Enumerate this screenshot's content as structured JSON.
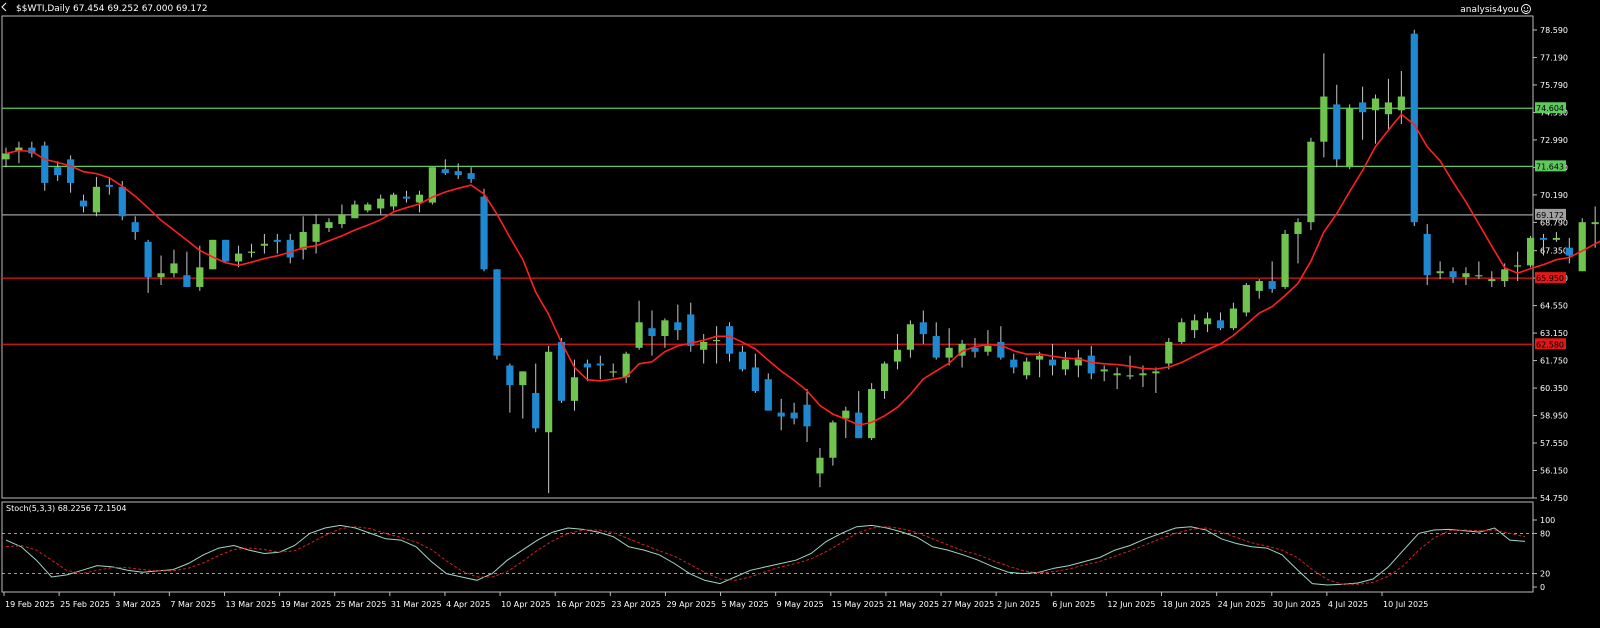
{
  "header": {
    "symbol_info": "$$WTI,Daily  67.454 69.252 67.000 69.172",
    "watermark": "analysis4you"
  },
  "chart_data": [
    {
      "type": "candlestick",
      "symbol": "$$WTI",
      "timeframe": "Daily",
      "ohlc_last": {
        "open": 67.454,
        "high": 69.252,
        "low": 67.0,
        "close": 69.172
      },
      "ylim": [
        54.75,
        79.2
      ],
      "y_ticks": [
        "78.590",
        "77.190",
        "75.790",
        "74.390",
        "72.990",
        "71.590",
        "70.190",
        "68.790",
        "67.350",
        "65.950",
        "64.550",
        "63.150",
        "61.750",
        "60.350",
        "58.950",
        "57.550",
        "56.150",
        "54.750"
      ],
      "x_tick_labels": [
        "19 Feb 2025",
        "25 Feb 2025",
        "3 Mar 2025",
        "7 Mar 2025",
        "13 Mar 2025",
        "19 Mar 2025",
        "25 Mar 2025",
        "31 Mar 2025",
        "4 Apr 2025",
        "10 Apr 2025",
        "16 Apr 2025",
        "23 Apr 2025",
        "29 Apr 2025",
        "5 May 2025",
        "9 May 2025",
        "15 May 2025",
        "21 May 2025",
        "27 May 2025",
        "2 Jun 2025",
        "6 Jun 2025",
        "12 Jun 2025",
        "18 Jun 2025",
        "24 Jun 2025",
        "30 Jun 2025",
        "4 Jul 2025",
        "10 Jul 2025"
      ],
      "candles": [
        {
          "o": 72.0,
          "h": 72.6,
          "l": 71.6,
          "c": 72.3
        },
        {
          "o": 72.4,
          "h": 72.9,
          "l": 71.8,
          "c": 72.6
        },
        {
          "o": 72.6,
          "h": 72.9,
          "l": 72.1,
          "c": 72.3
        },
        {
          "o": 72.7,
          "h": 72.9,
          "l": 70.4,
          "c": 70.8
        },
        {
          "o": 71.6,
          "h": 71.9,
          "l": 70.9,
          "c": 71.2
        },
        {
          "o": 72.0,
          "h": 72.2,
          "l": 70.3,
          "c": 70.8
        },
        {
          "o": 69.9,
          "h": 70.2,
          "l": 69.3,
          "c": 69.6
        },
        {
          "o": 69.3,
          "h": 71.1,
          "l": 69.1,
          "c": 70.6
        },
        {
          "o": 70.7,
          "h": 71.1,
          "l": 70.2,
          "c": 70.6
        },
        {
          "o": 70.6,
          "h": 70.9,
          "l": 68.9,
          "c": 69.1
        },
        {
          "o": 68.8,
          "h": 69.1,
          "l": 67.9,
          "c": 68.3
        },
        {
          "o": 67.8,
          "h": 67.9,
          "l": 65.2,
          "c": 66.0
        },
        {
          "o": 66.0,
          "h": 67.1,
          "l": 65.6,
          "c": 66.2
        },
        {
          "o": 66.2,
          "h": 67.4,
          "l": 66.0,
          "c": 66.7
        },
        {
          "o": 66.1,
          "h": 67.3,
          "l": 65.5,
          "c": 65.5
        },
        {
          "o": 65.5,
          "h": 67.6,
          "l": 65.3,
          "c": 66.5
        },
        {
          "o": 66.4,
          "h": 67.9,
          "l": 66.4,
          "c": 67.9
        },
        {
          "o": 67.9,
          "h": 67.9,
          "l": 66.7,
          "c": 66.8
        },
        {
          "o": 66.8,
          "h": 67.6,
          "l": 66.5,
          "c": 67.2
        },
        {
          "o": 67.3,
          "h": 67.7,
          "l": 67.0,
          "c": 67.3
        },
        {
          "o": 67.6,
          "h": 68.2,
          "l": 67.2,
          "c": 67.7
        },
        {
          "o": 67.9,
          "h": 68.2,
          "l": 67.2,
          "c": 67.8
        },
        {
          "o": 67.9,
          "h": 68.2,
          "l": 66.7,
          "c": 67.0
        },
        {
          "o": 67.4,
          "h": 69.1,
          "l": 66.9,
          "c": 68.3
        },
        {
          "o": 67.8,
          "h": 69.2,
          "l": 67.2,
          "c": 68.7
        },
        {
          "o": 68.5,
          "h": 69.0,
          "l": 68.3,
          "c": 68.8
        },
        {
          "o": 68.7,
          "h": 69.7,
          "l": 68.5,
          "c": 69.2
        },
        {
          "o": 69.0,
          "h": 69.9,
          "l": 69.0,
          "c": 69.7
        },
        {
          "o": 69.4,
          "h": 69.8,
          "l": 69.3,
          "c": 69.7
        },
        {
          "o": 69.5,
          "h": 70.2,
          "l": 69.2,
          "c": 70.0
        },
        {
          "o": 69.6,
          "h": 70.3,
          "l": 69.4,
          "c": 70.2
        },
        {
          "o": 70.1,
          "h": 70.4,
          "l": 69.8,
          "c": 70.0
        },
        {
          "o": 69.8,
          "h": 70.4,
          "l": 69.3,
          "c": 70.2
        },
        {
          "o": 69.8,
          "h": 71.6,
          "l": 69.7,
          "c": 71.6
        },
        {
          "o": 71.5,
          "h": 72.0,
          "l": 71.2,
          "c": 71.3
        },
        {
          "o": 71.4,
          "h": 71.8,
          "l": 71.0,
          "c": 71.2
        },
        {
          "o": 71.3,
          "h": 71.6,
          "l": 70.8,
          "c": 71.0
        },
        {
          "o": 70.1,
          "h": 70.5,
          "l": 66.3,
          "c": 66.4
        },
        {
          "o": 66.4,
          "h": 66.4,
          "l": 61.8,
          "c": 62.0
        },
        {
          "o": 61.5,
          "h": 61.6,
          "l": 59.1,
          "c": 60.5
        },
        {
          "o": 60.5,
          "h": 61.2,
          "l": 58.8,
          "c": 61.2
        },
        {
          "o": 60.1,
          "h": 61.6,
          "l": 58.1,
          "c": 58.3
        },
        {
          "o": 58.1,
          "h": 62.5,
          "l": 55.0,
          "c": 62.2
        },
        {
          "o": 62.7,
          "h": 62.9,
          "l": 59.6,
          "c": 59.7
        },
        {
          "o": 59.7,
          "h": 61.8,
          "l": 59.2,
          "c": 60.9
        },
        {
          "o": 61.6,
          "h": 61.8,
          "l": 60.7,
          "c": 61.4
        },
        {
          "o": 61.6,
          "h": 62.0,
          "l": 60.8,
          "c": 61.5
        },
        {
          "o": 61.2,
          "h": 61.6,
          "l": 60.9,
          "c": 61.2
        },
        {
          "o": 60.9,
          "h": 62.2,
          "l": 60.6,
          "c": 62.1
        },
        {
          "o": 62.4,
          "h": 64.8,
          "l": 62.3,
          "c": 63.7
        },
        {
          "o": 63.4,
          "h": 64.3,
          "l": 62.0,
          "c": 63.0
        },
        {
          "o": 63.0,
          "h": 63.9,
          "l": 62.4,
          "c": 63.8
        },
        {
          "o": 63.7,
          "h": 64.6,
          "l": 62.8,
          "c": 63.3
        },
        {
          "o": 64.1,
          "h": 64.7,
          "l": 62.2,
          "c": 62.5
        },
        {
          "o": 62.3,
          "h": 63.1,
          "l": 61.6,
          "c": 62.7
        },
        {
          "o": 62.8,
          "h": 63.5,
          "l": 61.6,
          "c": 62.8
        },
        {
          "o": 63.5,
          "h": 63.7,
          "l": 61.7,
          "c": 62.1
        },
        {
          "o": 62.2,
          "h": 62.5,
          "l": 61.2,
          "c": 61.3
        },
        {
          "o": 61.4,
          "h": 62.1,
          "l": 60.1,
          "c": 60.2
        },
        {
          "o": 60.8,
          "h": 61.1,
          "l": 59.2,
          "c": 59.2
        },
        {
          "o": 59.1,
          "h": 59.8,
          "l": 58.2,
          "c": 58.9
        },
        {
          "o": 59.1,
          "h": 59.6,
          "l": 58.5,
          "c": 58.8
        },
        {
          "o": 59.5,
          "h": 60.3,
          "l": 57.6,
          "c": 58.4
        },
        {
          "o": 56.0,
          "h": 57.3,
          "l": 55.3,
          "c": 56.8
        },
        {
          "o": 56.8,
          "h": 58.7,
          "l": 56.4,
          "c": 58.6
        },
        {
          "o": 58.8,
          "h": 59.4,
          "l": 57.8,
          "c": 59.2
        },
        {
          "o": 59.1,
          "h": 60.2,
          "l": 57.8,
          "c": 57.8
        },
        {
          "o": 57.8,
          "h": 60.6,
          "l": 57.7,
          "c": 60.3
        },
        {
          "o": 60.2,
          "h": 61.7,
          "l": 59.8,
          "c": 61.6
        },
        {
          "o": 61.7,
          "h": 63.1,
          "l": 61.3,
          "c": 62.3
        },
        {
          "o": 62.3,
          "h": 63.8,
          "l": 61.9,
          "c": 63.6
        },
        {
          "o": 63.7,
          "h": 64.3,
          "l": 62.6,
          "c": 63.1
        },
        {
          "o": 63.0,
          "h": 63.7,
          "l": 61.8,
          "c": 61.9
        },
        {
          "o": 61.9,
          "h": 63.4,
          "l": 61.5,
          "c": 62.4
        },
        {
          "o": 62.0,
          "h": 62.8,
          "l": 61.4,
          "c": 62.6
        },
        {
          "o": 62.4,
          "h": 62.9,
          "l": 61.9,
          "c": 62.2
        },
        {
          "o": 62.2,
          "h": 63.3,
          "l": 62.0,
          "c": 62.5
        },
        {
          "o": 62.7,
          "h": 63.5,
          "l": 61.8,
          "c": 61.9
        },
        {
          "o": 61.8,
          "h": 62.1,
          "l": 61.1,
          "c": 61.4
        },
        {
          "o": 61.0,
          "h": 61.9,
          "l": 60.8,
          "c": 61.7
        },
        {
          "o": 61.8,
          "h": 62.2,
          "l": 60.9,
          "c": 62.0
        },
        {
          "o": 61.8,
          "h": 62.6,
          "l": 61.0,
          "c": 61.5
        },
        {
          "o": 61.3,
          "h": 62.2,
          "l": 61.0,
          "c": 61.8
        },
        {
          "o": 61.5,
          "h": 62.3,
          "l": 60.9,
          "c": 61.9
        },
        {
          "o": 62.0,
          "h": 62.5,
          "l": 60.8,
          "c": 61.1
        },
        {
          "o": 61.2,
          "h": 61.5,
          "l": 60.7,
          "c": 61.3
        },
        {
          "o": 61.0,
          "h": 61.4,
          "l": 60.3,
          "c": 61.1
        },
        {
          "o": 61.0,
          "h": 62.0,
          "l": 60.8,
          "c": 61.0
        },
        {
          "o": 61.0,
          "h": 61.5,
          "l": 60.4,
          "c": 61.1
        },
        {
          "o": 61.1,
          "h": 61.4,
          "l": 60.1,
          "c": 61.2
        },
        {
          "o": 61.6,
          "h": 62.9,
          "l": 61.3,
          "c": 62.7
        },
        {
          "o": 62.7,
          "h": 63.9,
          "l": 62.6,
          "c": 63.7
        },
        {
          "o": 63.3,
          "h": 64.1,
          "l": 62.9,
          "c": 63.8
        },
        {
          "o": 63.6,
          "h": 64.2,
          "l": 63.2,
          "c": 63.9
        },
        {
          "o": 63.8,
          "h": 64.2,
          "l": 63.3,
          "c": 63.4
        },
        {
          "o": 63.4,
          "h": 64.7,
          "l": 63.3,
          "c": 64.4
        },
        {
          "o": 64.2,
          "h": 65.7,
          "l": 64.0,
          "c": 65.6
        },
        {
          "o": 65.3,
          "h": 65.9,
          "l": 64.9,
          "c": 65.8
        },
        {
          "o": 65.8,
          "h": 66.8,
          "l": 65.2,
          "c": 65.4
        },
        {
          "o": 65.5,
          "h": 68.4,
          "l": 65.4,
          "c": 68.2
        },
        {
          "o": 68.2,
          "h": 69.0,
          "l": 66.7,
          "c": 68.8
        },
        {
          "o": 68.8,
          "h": 73.1,
          "l": 68.4,
          "c": 72.9
        },
        {
          "o": 72.9,
          "h": 77.4,
          "l": 72.1,
          "c": 75.2
        },
        {
          "o": 74.8,
          "h": 75.8,
          "l": 71.6,
          "c": 72.0
        },
        {
          "o": 71.6,
          "h": 74.8,
          "l": 71.5,
          "c": 74.6
        },
        {
          "o": 74.9,
          "h": 75.7,
          "l": 73.0,
          "c": 74.4
        },
        {
          "o": 74.5,
          "h": 75.3,
          "l": 72.8,
          "c": 75.1
        },
        {
          "o": 74.3,
          "h": 76.1,
          "l": 73.5,
          "c": 74.9
        },
        {
          "o": 74.5,
          "h": 76.5,
          "l": 73.8,
          "c": 75.2
        },
        {
          "o": 78.4,
          "h": 78.6,
          "l": 68.6,
          "c": 68.8
        },
        {
          "o": 68.2,
          "h": 68.7,
          "l": 65.6,
          "c": 66.1
        },
        {
          "o": 66.2,
          "h": 66.8,
          "l": 65.9,
          "c": 66.3
        },
        {
          "o": 66.3,
          "h": 66.5,
          "l": 65.7,
          "c": 66.0
        },
        {
          "o": 66.0,
          "h": 66.5,
          "l": 65.6,
          "c": 66.2
        },
        {
          "o": 66.1,
          "h": 66.8,
          "l": 65.9,
          "c": 66.1
        },
        {
          "o": 65.8,
          "h": 66.3,
          "l": 65.5,
          "c": 65.9
        },
        {
          "o": 65.8,
          "h": 66.7,
          "l": 65.5,
          "c": 66.4
        },
        {
          "o": 66.6,
          "h": 67.3,
          "l": 65.8,
          "c": 66.6
        },
        {
          "o": 66.6,
          "h": 68.1,
          "l": 66.5,
          "c": 68.0
        },
        {
          "o": 68.0,
          "h": 68.2,
          "l": 67.1,
          "c": 67.9
        },
        {
          "o": 67.9,
          "h": 68.3,
          "l": 67.8,
          "c": 68.0
        },
        {
          "o": 67.5,
          "h": 68.0,
          "l": 66.7,
          "c": 67.1
        },
        {
          "o": 66.3,
          "h": 69.0,
          "l": 66.3,
          "c": 68.8
        },
        {
          "o": 68.7,
          "h": 69.6,
          "l": 67.5,
          "c": 68.8
        },
        {
          "o": 68.9,
          "h": 69.3,
          "l": 68.6,
          "c": 69.0
        },
        {
          "o": 68.9,
          "h": 69.6,
          "l": 68.0,
          "c": 68.5
        },
        {
          "o": 68.8,
          "h": 69.2,
          "l": 67.0,
          "c": 67.4
        },
        {
          "o": 67.454,
          "h": 69.252,
          "l": 67.0,
          "c": 69.172
        }
      ],
      "moving_average": {
        "period": 8,
        "color": "#ff2020"
      },
      "horizontal_levels": [
        {
          "value": 74.604,
          "label": "74.604",
          "color": "#5ec95e"
        },
        {
          "value": 71.643,
          "label": "71.643",
          "color": "#5ec95e"
        },
        {
          "value": 69.172,
          "label": "69.172",
          "color": "#a0a0a0"
        },
        {
          "value": 65.95,
          "label": "65.950",
          "color": "#e01818"
        },
        {
          "value": 62.58,
          "label": "62.580",
          "color": "#e01818"
        }
      ],
      "colors": {
        "bull": "#6fc44f",
        "bear": "#1e88d0",
        "background": "#000000",
        "axis": "#c0c0c0"
      }
    },
    {
      "type": "line",
      "title": "Stoch(5,3,3) 68.2256 72.1504",
      "ylim": [
        0,
        100
      ],
      "y_ticks": [
        "100",
        "80",
        "20",
        "0"
      ],
      "levels": [
        80,
        20
      ],
      "series": [
        {
          "name": "Main",
          "color": "#9fd7c4",
          "style": "solid",
          "values": [
            70,
            60,
            40,
            15,
            18,
            25,
            32,
            30,
            25,
            22,
            24,
            26,
            35,
            48,
            58,
            62,
            55,
            50,
            52,
            62,
            80,
            88,
            92,
            88,
            80,
            72,
            70,
            60,
            38,
            20,
            15,
            10,
            20,
            40,
            55,
            70,
            82,
            88,
            86,
            82,
            75,
            60,
            55,
            48,
            35,
            20,
            10,
            5,
            15,
            25,
            30,
            35,
            40,
            50,
            68,
            80,
            90,
            92,
            88,
            82,
            74,
            60,
            55,
            48,
            40,
            30,
            22,
            20,
            22,
            28,
            32,
            38,
            44,
            55,
            62,
            72,
            80,
            88,
            90,
            85,
            72,
            65,
            60,
            58,
            48,
            26,
            5,
            3,
            4,
            6,
            12,
            30,
            55,
            80,
            85,
            86,
            84,
            82,
            88,
            70,
            68
          ]
        },
        {
          "name": "Signal",
          "color": "#d02020",
          "style": "dashed",
          "values": [
            60,
            62,
            55,
            40,
            25,
            20,
            25,
            29,
            29,
            26,
            24,
            24,
            28,
            36,
            47,
            56,
            58,
            56,
            52,
            54,
            65,
            77,
            87,
            90,
            87,
            80,
            74,
            67,
            56,
            39,
            24,
            15,
            15,
            23,
            38,
            55,
            69,
            80,
            85,
            85,
            81,
            72,
            63,
            54,
            46,
            34,
            22,
            12,
            10,
            15,
            23,
            30,
            35,
            42,
            53,
            66,
            80,
            88,
            90,
            87,
            81,
            72,
            63,
            54,
            48,
            39,
            31,
            24,
            21,
            23,
            27,
            33,
            38,
            46,
            54,
            63,
            72,
            80,
            86,
            88,
            82,
            74,
            66,
            61,
            55,
            44,
            26,
            11,
            4,
            4,
            7,
            16,
            32,
            55,
            73,
            84,
            85,
            84,
            85,
            80,
            75
          ]
        }
      ],
      "x_tick_labels": [
        "19 Feb 2025",
        "25 Feb 2025",
        "3 Mar 2025",
        "7 Mar 2025",
        "13 Mar 2025",
        "19 Mar 2025",
        "25 Mar 2025",
        "31 Mar 2025",
        "4 Apr 2025",
        "10 Apr 2025",
        "16 Apr 2025",
        "23 Apr 2025",
        "29 Apr 2025",
        "5 May 2025",
        "9 May 2025",
        "15 May 2025",
        "21 May 2025",
        "27 May 2025",
        "2 Jun 2025",
        "6 Jun 2025",
        "12 Jun 2025",
        "18 Jun 2025",
        "24 Jun 2025",
        "30 Jun 2025",
        "4 Jul 2025",
        "10 Jul 2025"
      ]
    }
  ]
}
